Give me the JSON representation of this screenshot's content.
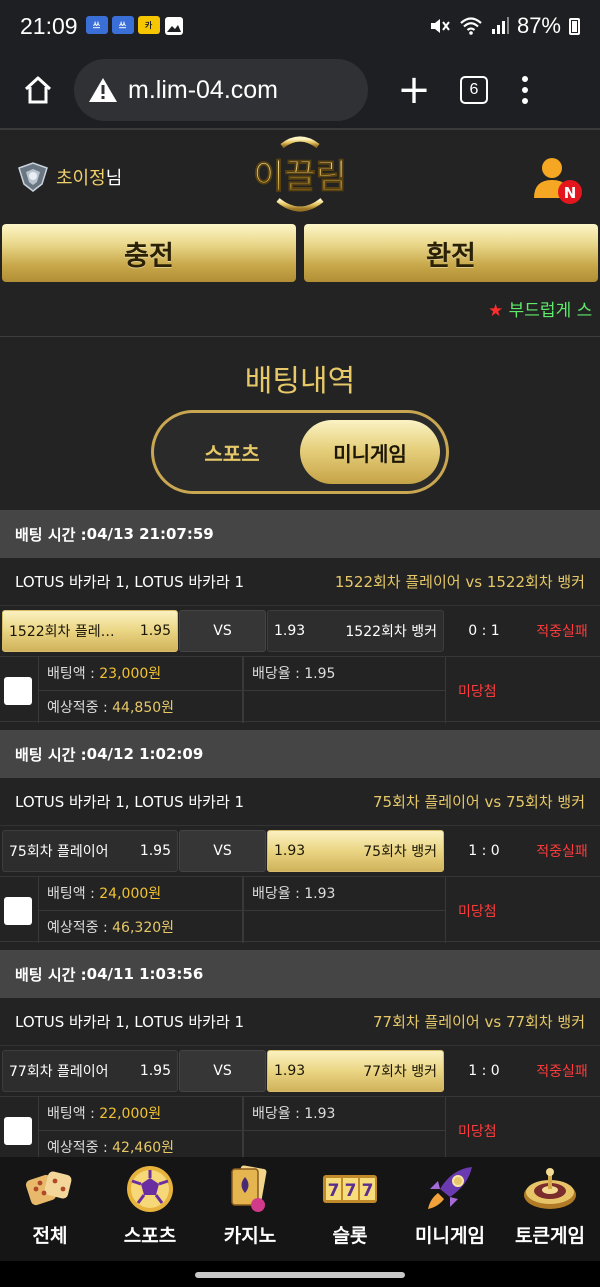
{
  "statusbar": {
    "time": "21:09",
    "battery": "87%",
    "apps": [
      "쓰",
      "쓰",
      "카"
    ]
  },
  "browser": {
    "url": "m.lim-04.com",
    "tab_count": "6"
  },
  "header": {
    "user_nick": "초이정",
    "user_suffix": "님",
    "logo_text": "이끌림",
    "notif_badge": "N"
  },
  "buttons": {
    "charge": "충전",
    "exchange": "환전"
  },
  "ticker": {
    "star": "★",
    "text": "부드럽게 스"
  },
  "page": {
    "title": "배팅내역",
    "toggle_sports": "스포츠",
    "toggle_mini": "미니게임",
    "active_tab": "미니게임"
  },
  "labels": {
    "bet_time_prefix": "배팅 시간 : ",
    "vs": "VS",
    "bet_amount": "배팅액 : ",
    "odds": "배당율 : ",
    "expected": "예상적중 : ",
    "pick_vs": "vs"
  },
  "bets": [
    {
      "time": "04/13 21:07:59",
      "game": "LOTUS 바카라 1, LOTUS 바카라 1",
      "pick_home": "1522회차 플레이어",
      "pick_away": "1522회차 뱅커",
      "home_name": "1522회차 플레…",
      "home_odds": "1.95",
      "away_odds": "1.93",
      "away_name": "1522회차 뱅커",
      "selected": "home",
      "score": "0 : 1",
      "result": "적중실패",
      "amount": "23,000원",
      "bet_odds": "1.95",
      "expected": "44,850원",
      "status": "미당첨"
    },
    {
      "time": "04/12 1:02:09",
      "game": "LOTUS 바카라 1, LOTUS 바카라 1",
      "pick_home": "75회차 플레이어",
      "pick_away": "75회차 뱅커",
      "home_name": "75회차 플레이어",
      "home_odds": "1.95",
      "away_odds": "1.93",
      "away_name": "75회차 뱅커",
      "selected": "away",
      "score": "1 : 0",
      "result": "적중실패",
      "amount": "24,000원",
      "bet_odds": "1.93",
      "expected": "46,320원",
      "status": "미당첨"
    },
    {
      "time": "04/11 1:03:56",
      "game": "LOTUS 바카라 1, LOTUS 바카라 1",
      "pick_home": "77회차 플레이어",
      "pick_away": "77회차 뱅커",
      "home_name": "77회차 플레이어",
      "home_odds": "1.95",
      "away_odds": "1.93",
      "away_name": "77회차 뱅커",
      "selected": "away",
      "score": "1 : 0",
      "result": "적중실패",
      "amount": "22,000원",
      "bet_odds": "1.93",
      "expected": "42,460원",
      "status": "미당첨"
    }
  ],
  "nav": [
    {
      "label": "전체",
      "icon": "dice-icon"
    },
    {
      "label": "스포츠",
      "icon": "soccer-ball-icon"
    },
    {
      "label": "카지노",
      "icon": "playing-cards-icon"
    },
    {
      "label": "슬롯",
      "icon": "slot-777-icon"
    },
    {
      "label": "미니게임",
      "icon": "rocket-icon"
    },
    {
      "label": "토큰게임",
      "icon": "roulette-icon"
    }
  ],
  "colors": {
    "gold": "#e6c868",
    "fail_red": "#ff3b3b",
    "ticker_green": "#5eea6a"
  }
}
